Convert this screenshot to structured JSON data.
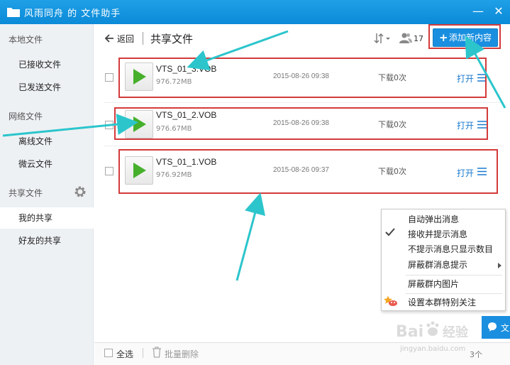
{
  "window": {
    "title": "风雨同舟 的 文件助手",
    "minimize_glyph": "—",
    "close_glyph": "✕"
  },
  "sidebar": {
    "sections": {
      "local": "本地文件",
      "network": "网络文件",
      "shared": "共享文件"
    },
    "items": [
      {
        "label": "已接收文件"
      },
      {
        "label": "已发送文件"
      },
      {
        "label": "离线文件"
      },
      {
        "label": "微云文件"
      },
      {
        "label": "我的共享"
      },
      {
        "label": "好友的共享"
      }
    ],
    "active_item": "我的共享"
  },
  "header": {
    "back_label": "返回",
    "page_title": "共享文件",
    "member_count": "17",
    "add_button_label": "添加新内容"
  },
  "files": [
    {
      "name": "VTS_01_3.VOB",
      "size": "976.72MB",
      "date": "2015-08-26 09:38",
      "downloads": "下载0次",
      "open_label": "打开"
    },
    {
      "name": "VTS_01_2.VOB",
      "size": "976.67MB",
      "date": "2015-08-26 09:38",
      "downloads": "下载0次",
      "open_label": "打开"
    },
    {
      "name": "VTS_01_1.VOB",
      "size": "976.92MB",
      "date": "2015-08-26 09:37",
      "downloads": "下载0次",
      "open_label": "打开"
    }
  ],
  "bottom_bar": {
    "select_all": "全选",
    "batch_delete": "批量删除",
    "count": "3个"
  },
  "context_menu": {
    "items": [
      {
        "label": "自动弹出消息"
      },
      {
        "label": "接收并提示消息",
        "checked": true
      },
      {
        "label": "不提示消息只显示数目"
      },
      {
        "label": "屏蔽群消息提示",
        "has_submenu": true
      },
      {
        "label": "屏蔽群内图片"
      },
      {
        "label": "设置本群特别关注"
      }
    ]
  },
  "chat_tab": {
    "label": "文"
  },
  "watermark": {
    "text": "Bai度经验",
    "url_text": "jingyan.baidu.com"
  },
  "colors": {
    "titlebar": "#0b8ad8",
    "accent": "#1a8fe0",
    "play": "#46b02c",
    "highlight_box": "#d33b3b",
    "annotation_arrow": "#2cc5cc",
    "link": "#1a7ad0"
  },
  "icons": {
    "folder": "folder-icon",
    "back": "back-arrow-icon",
    "sort": "sort-icon",
    "members": "members-icon",
    "add": "plus-icon",
    "play": "play-icon",
    "menu": "hamburger-icon",
    "gear": "gear-icon",
    "trash": "trash-icon",
    "check": "check-icon",
    "star": "star-icon",
    "chat": "chat-bubble-icon"
  }
}
